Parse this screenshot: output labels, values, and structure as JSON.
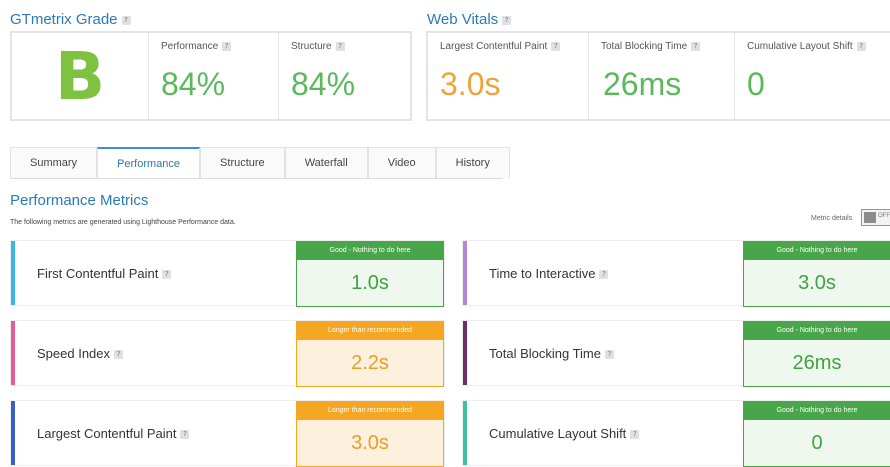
{
  "grade": {
    "title": "GTmetrix Grade",
    "letter": "B",
    "performance": {
      "label": "Performance",
      "value": "84%"
    },
    "structure": {
      "label": "Structure",
      "value": "84%"
    }
  },
  "vitals": {
    "title": "Web Vitals",
    "lcp": {
      "label": "Largest Contentful Paint",
      "value": "3.0s"
    },
    "tbt": {
      "label": "Total Blocking Time",
      "value": "26ms"
    },
    "cls": {
      "label": "Cumulative Layout Shift",
      "value": "0"
    }
  },
  "help_glyph": "?",
  "tabs": [
    "Summary",
    "Performance",
    "Structure",
    "Waterfall",
    "Video",
    "History"
  ],
  "active_tab": "Performance",
  "metrics_section": {
    "title": "Performance Metrics",
    "description": "The following metrics are generated using Lighthouse Performance data.",
    "details_label": "Metric details",
    "toggle_text": "OFF"
  },
  "metrics": [
    {
      "name": "First Contentful Paint",
      "status": "Good - Nothing to do here",
      "value": "1.0s",
      "accent": "#3bb4e6"
    },
    {
      "name": "Time to Interactive",
      "status": "Good - Nothing to do here",
      "value": "3.0s",
      "accent": "#b386d6"
    },
    {
      "name": "Speed Index",
      "status": "Longer than recommended",
      "value": "2.2s",
      "accent": "#e35d92"
    },
    {
      "name": "Total Blocking Time",
      "status": "Good - Nothing to do here",
      "value": "26ms",
      "accent": "#6b2d6b"
    },
    {
      "name": "Largest Contentful Paint",
      "status": "Longer than recommended",
      "value": "3.0s",
      "accent": "#3b5fc9"
    },
    {
      "name": "Cumulative Layout Shift",
      "status": "Good - Nothing to do here",
      "value": "0",
      "accent": "#3ec1a0"
    }
  ],
  "colors": {
    "good": "#49a54a",
    "warning": "#f5a623",
    "link": "#2a7ab8"
  }
}
